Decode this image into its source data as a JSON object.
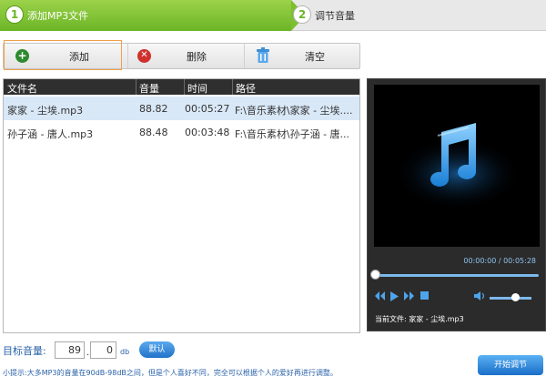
{
  "steps": [
    {
      "num": "1",
      "label": "添加MP3文件"
    },
    {
      "num": "2",
      "label": "调节音量"
    }
  ],
  "toolbar": {
    "add_label": "添加",
    "delete_label": "删除",
    "clear_label": "清空"
  },
  "table": {
    "headers": [
      "文件名",
      "音量",
      "时间",
      "路径"
    ],
    "rows": [
      {
        "name": "家家 - 尘埃.mp3",
        "volume": "88.82",
        "time": "00:05:27",
        "path": "F:\\音乐素材\\家家 - 尘埃...."
      },
      {
        "name": "孙子涵 - 唐人.mp3",
        "volume": "88.48",
        "time": "00:03:48",
        "path": "F:\\音乐素材\\孙子涵 - 唐..."
      }
    ]
  },
  "player": {
    "timecode": "00:00:00 / 00:05:28",
    "now_playing": "当前文件: 家家 - 尘埃.mp3",
    "icon": "music-note-icon",
    "progress": 0,
    "volume_level": 0.6
  },
  "target": {
    "label": "目标音量:",
    "int_value": "89",
    "dot": ".",
    "dec_value": "0",
    "unit": "db",
    "default_button": "默认"
  },
  "tip": "小提示:大多MP3的音量在90dB-98dB之间，但是个人喜好不同，完全可以根据个人的爱好再进行调整。",
  "start_button": "开始调节",
  "colors": {
    "step_active": "#6cb526",
    "accent_blue": "#2173c8",
    "selected_row": "#d9e8f7"
  }
}
